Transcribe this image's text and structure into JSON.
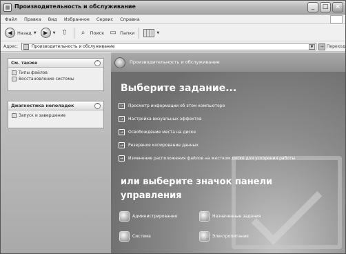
{
  "window": {
    "title": "Производительность и обслуживание",
    "buttons": {
      "minimize": "_",
      "maximize": "□",
      "close": "×"
    }
  },
  "menu": [
    "Файл",
    "Правка",
    "Вид",
    "Избранное",
    "Сервис",
    "Справка"
  ],
  "toolbar": {
    "back": "Назад",
    "search": "Поиск",
    "folders": "Папки"
  },
  "address": {
    "label": "Адрес:",
    "value": "Производительность и обслуживание",
    "go": "Переход"
  },
  "sidebar": {
    "see_also": {
      "title": "См. также",
      "items": [
        "Типы файлов",
        "Восстановление системы"
      ]
    },
    "troubleshoot": {
      "title": "Диагностика неполадок",
      "items": [
        "Запуск и завершение"
      ]
    }
  },
  "main": {
    "header": "Производительность и обслуживание",
    "pick_task": "Выберите задание...",
    "tasks": [
      "Просмотр информации об этом компьютере",
      "Настройка визуальных эффектов",
      "Освобождение места на диске",
      "Резервное копирование данных",
      "Изменение расположения файлов на жестком диске для ускорения работы"
    ],
    "pick_icon": "или выберите значок панели управления",
    "icons": [
      "Администрирование",
      "Назначенные задания",
      "Система",
      "Электропитание"
    ]
  }
}
